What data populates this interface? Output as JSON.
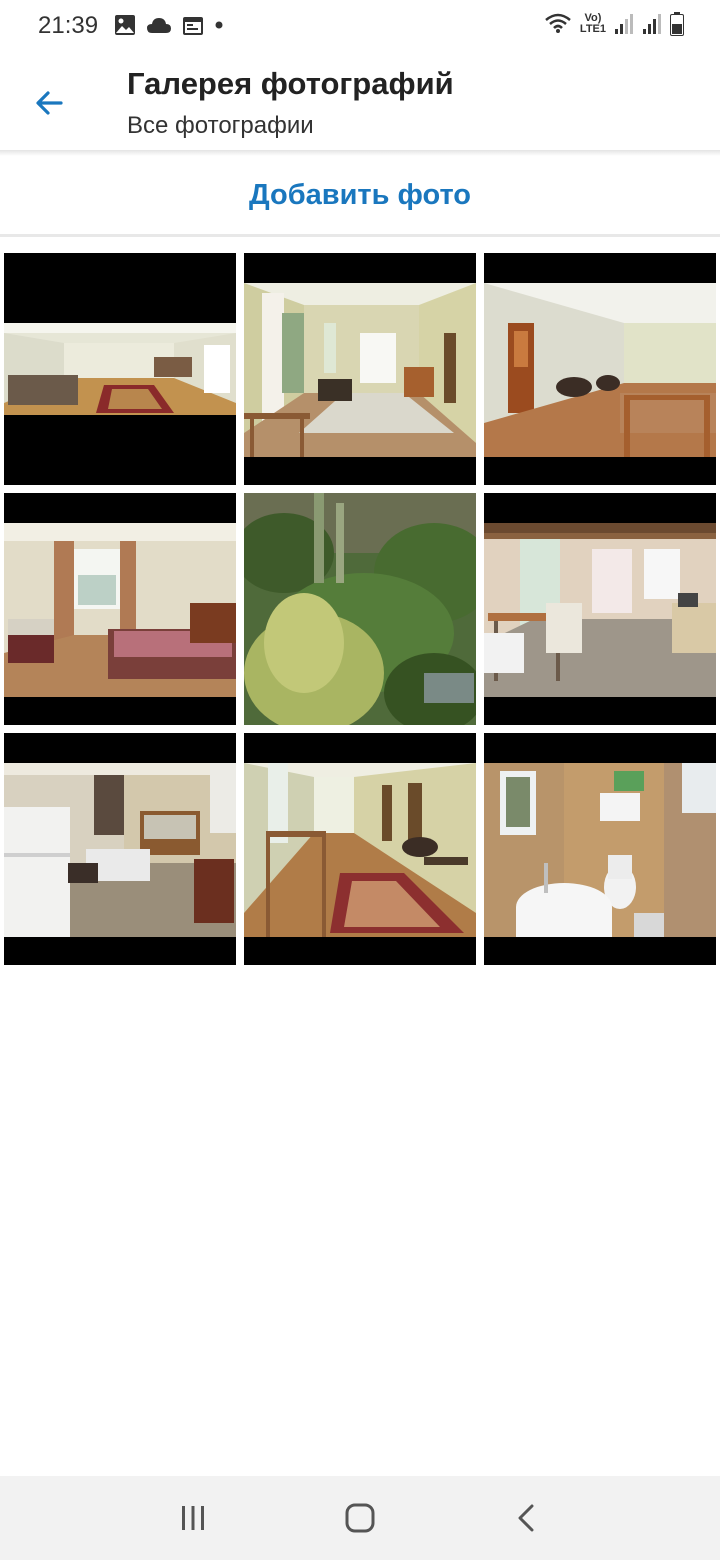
{
  "status_bar": {
    "time": "21:39",
    "left_icons": [
      "gallery-icon",
      "cloud-icon",
      "calendar-icon",
      "dot-icon"
    ],
    "right_icons": [
      "wifi-icon",
      "volte-icon",
      "signal-icon",
      "signal-icon",
      "battery-icon"
    ],
    "volte_top": "Vo)",
    "volte_bottom": "LTE1"
  },
  "header": {
    "back_icon": "arrow-left-icon",
    "title": "Галерея фотографий",
    "subtitle": "Все фотографии"
  },
  "actions": {
    "add_photo_label": "Добавить фото"
  },
  "colors": {
    "accent": "#1a77be",
    "letterbox": "#000000"
  },
  "photos": [
    {
      "subject": "room-with-carpet"
    },
    {
      "subject": "hall-with-windows"
    },
    {
      "subject": "room-with-door-and-stairs"
    },
    {
      "subject": "bedroom"
    },
    {
      "subject": "forest-view"
    },
    {
      "subject": "dining-room"
    },
    {
      "subject": "kitchen"
    },
    {
      "subject": "hallway-with-carpet"
    },
    {
      "subject": "bathroom"
    }
  ],
  "nav": {
    "recents_icon": "recents-icon",
    "home_icon": "home-icon",
    "back_icon": "back-icon"
  }
}
